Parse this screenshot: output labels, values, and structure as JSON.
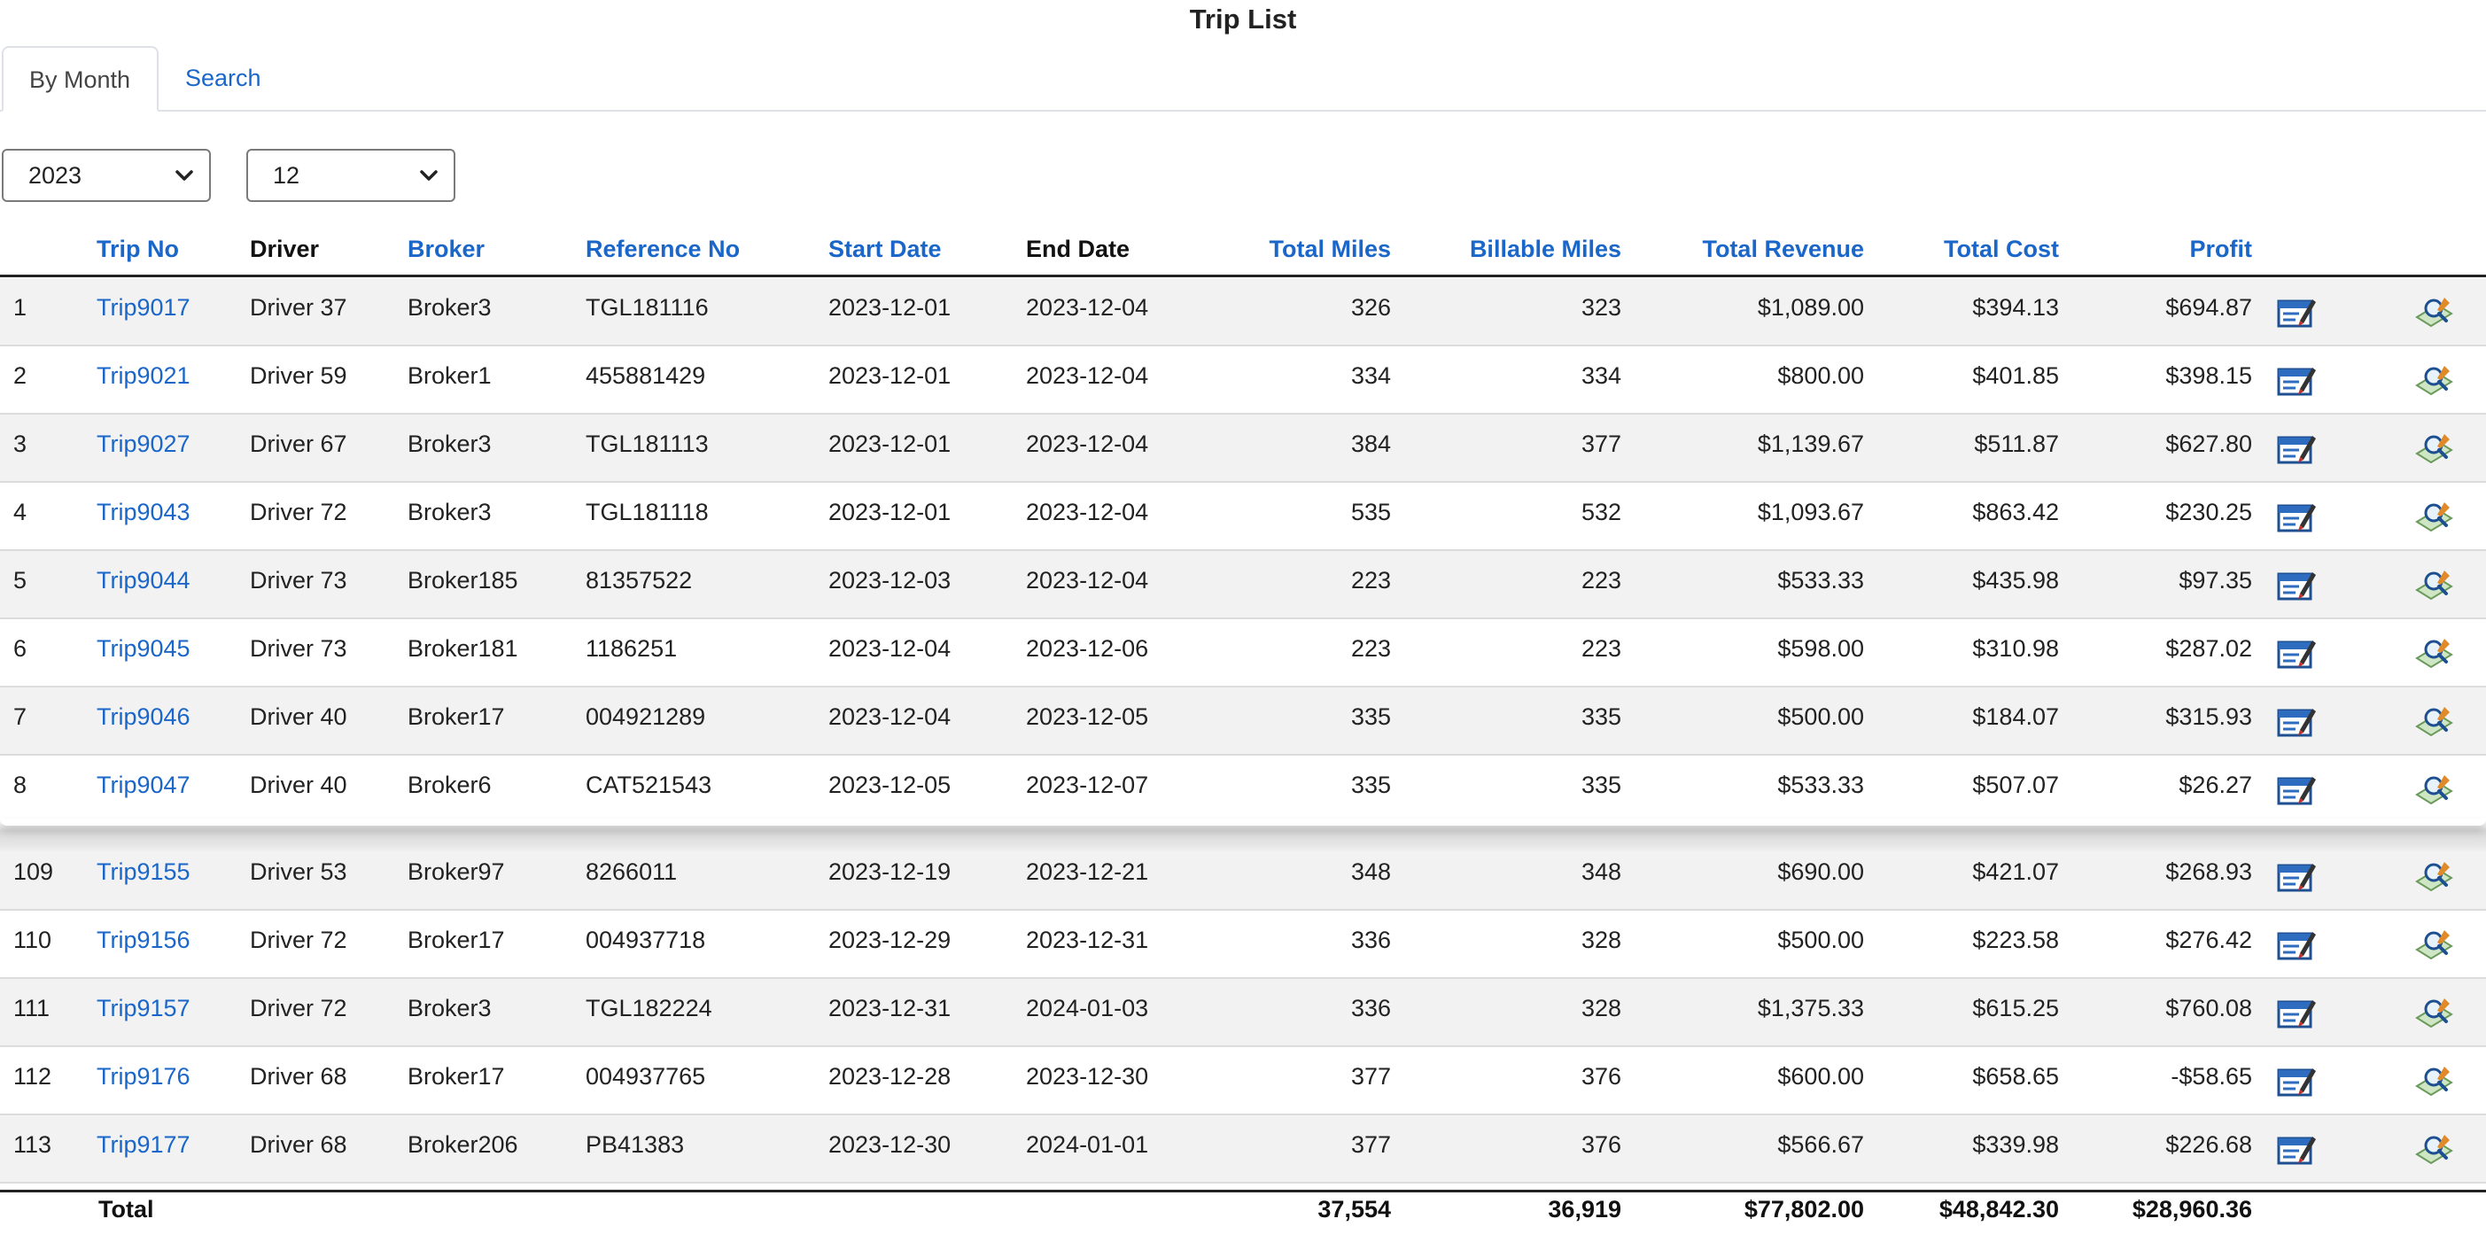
{
  "page": {
    "title": "Trip List"
  },
  "tabs": [
    {
      "label": "By Month",
      "active": true
    },
    {
      "label": "Search",
      "active": false
    }
  ],
  "filters": {
    "year": "2023",
    "month": "12"
  },
  "columns": {
    "index": "",
    "trip_no": "Trip No",
    "driver": "Driver",
    "broker": "Broker",
    "reference_no": "Reference No",
    "start_date": "Start Date",
    "end_date": "End Date",
    "total_miles": "Total Miles",
    "billable_miles": "Billable Miles",
    "total_revenue": "Total Revenue",
    "total_cost": "Total Cost",
    "profit": "Profit"
  },
  "rows": [
    {
      "idx": "1",
      "trip": "Trip9017",
      "driver": "Driver 37",
      "broker": "Broker3",
      "ref": "TGL181116",
      "start": "2023-12-01",
      "end": "2023-12-04",
      "miles": "326",
      "billable": "323",
      "revenue": "$1,089.00",
      "cost": "$394.13",
      "profit": "$694.87"
    },
    {
      "idx": "2",
      "trip": "Trip9021",
      "driver": "Driver 59",
      "broker": "Broker1",
      "ref": "455881429",
      "start": "2023-12-01",
      "end": "2023-12-04",
      "miles": "334",
      "billable": "334",
      "revenue": "$800.00",
      "cost": "$401.85",
      "profit": "$398.15"
    },
    {
      "idx": "3",
      "trip": "Trip9027",
      "driver": "Driver 67",
      "broker": "Broker3",
      "ref": "TGL181113",
      "start": "2023-12-01",
      "end": "2023-12-04",
      "miles": "384",
      "billable": "377",
      "revenue": "$1,139.67",
      "cost": "$511.87",
      "profit": "$627.80"
    },
    {
      "idx": "4",
      "trip": "Trip9043",
      "driver": "Driver 72",
      "broker": "Broker3",
      "ref": "TGL181118",
      "start": "2023-12-01",
      "end": "2023-12-04",
      "miles": "535",
      "billable": "532",
      "revenue": "$1,093.67",
      "cost": "$863.42",
      "profit": "$230.25"
    },
    {
      "idx": "5",
      "trip": "Trip9044",
      "driver": "Driver 73",
      "broker": "Broker185",
      "ref": "81357522",
      "start": "2023-12-03",
      "end": "2023-12-04",
      "miles": "223",
      "billable": "223",
      "revenue": "$533.33",
      "cost": "$435.98",
      "profit": "$97.35"
    },
    {
      "idx": "6",
      "trip": "Trip9045",
      "driver": "Driver 73",
      "broker": "Broker181",
      "ref": "1186251",
      "start": "2023-12-04",
      "end": "2023-12-06",
      "miles": "223",
      "billable": "223",
      "revenue": "$598.00",
      "cost": "$310.98",
      "profit": "$287.02"
    },
    {
      "idx": "7",
      "trip": "Trip9046",
      "driver": "Driver 40",
      "broker": "Broker17",
      "ref": "004921289",
      "start": "2023-12-04",
      "end": "2023-12-05",
      "miles": "335",
      "billable": "335",
      "revenue": "$500.00",
      "cost": "$184.07",
      "profit": "$315.93"
    },
    {
      "idx": "8",
      "trip": "Trip9047",
      "driver": "Driver 40",
      "broker": "Broker6",
      "ref": "CAT521543",
      "start": "2023-12-05",
      "end": "2023-12-07",
      "miles": "335",
      "billable": "335",
      "revenue": "$533.33",
      "cost": "$507.07",
      "profit": "$26.27"
    },
    {
      "idx": "109",
      "trip": "Trip9155",
      "driver": "Driver 53",
      "broker": "Broker97",
      "ref": "8266011",
      "start": "2023-12-19",
      "end": "2023-12-21",
      "miles": "348",
      "billable": "348",
      "revenue": "$690.00",
      "cost": "$421.07",
      "profit": "$268.93"
    },
    {
      "idx": "110",
      "trip": "Trip9156",
      "driver": "Driver 72",
      "broker": "Broker17",
      "ref": "004937718",
      "start": "2023-12-29",
      "end": "2023-12-31",
      "miles": "336",
      "billable": "328",
      "revenue": "$500.00",
      "cost": "$223.58",
      "profit": "$276.42"
    },
    {
      "idx": "111",
      "trip": "Trip9157",
      "driver": "Driver 72",
      "broker": "Broker3",
      "ref": "TGL182224",
      "start": "2023-12-31",
      "end": "2024-01-03",
      "miles": "336",
      "billable": "328",
      "revenue": "$1,375.33",
      "cost": "$615.25",
      "profit": "$760.08"
    },
    {
      "idx": "112",
      "trip": "Trip9176",
      "driver": "Driver 68",
      "broker": "Broker17",
      "ref": "004937765",
      "start": "2023-12-28",
      "end": "2023-12-30",
      "miles": "377",
      "billable": "376",
      "revenue": "$600.00",
      "cost": "$658.65",
      "profit": "-$58.65"
    },
    {
      "idx": "113",
      "trip": "Trip9177",
      "driver": "Driver 68",
      "broker": "Broker206",
      "ref": "PB41383",
      "start": "2023-12-30",
      "end": "2024-01-01",
      "miles": "377",
      "billable": "376",
      "revenue": "$566.67",
      "cost": "$339.98",
      "profit": "$226.68"
    }
  ],
  "totals": {
    "label": "Total",
    "miles": "37,554",
    "billable": "36,919",
    "revenue": "$77,802.00",
    "cost": "$48,842.30",
    "profit": "$28,960.36"
  },
  "icons": {
    "edit": "edit-invoice-icon",
    "view": "view-detail-icon"
  },
  "colors": {
    "link": "#1a66c9",
    "row_alt": "#f2f2f2"
  }
}
